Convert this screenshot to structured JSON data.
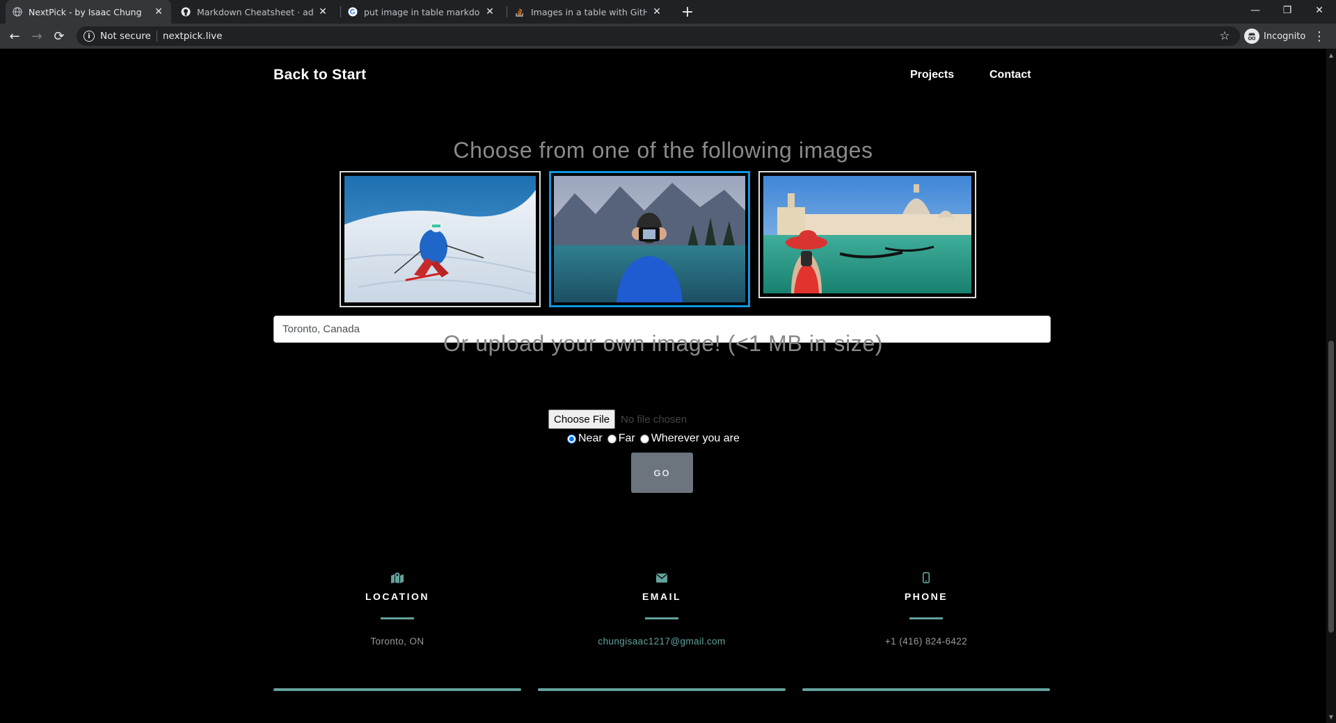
{
  "browser": {
    "tabs": [
      {
        "title": "NextPick - by Isaac Chung",
        "icon": "globe-icon",
        "active": true
      },
      {
        "title": "Markdown Cheatsheet · adam-p/",
        "icon": "github-icon",
        "active": false
      },
      {
        "title": "put image in table markdown - G",
        "icon": "google-icon",
        "active": false
      },
      {
        "title": "Images in a table with GitHub ma",
        "icon": "stackoverflow-icon",
        "active": false
      }
    ],
    "security_label": "Not secure",
    "url": "nextpick.live",
    "profile_label": "Incognito"
  },
  "nav": {
    "brand": "Back to Start",
    "links": [
      "Projects",
      "Contact"
    ]
  },
  "chooser": {
    "heading": "Choose from one of the following images",
    "images": [
      {
        "subject": "skier on snowy slope",
        "selected": false
      },
      {
        "subject": "person taking selfie by mountain lake",
        "selected": true
      },
      {
        "subject": "woman in red hat at Venice canal",
        "selected": false
      }
    ],
    "location_value": "Toronto, Canada"
  },
  "upload": {
    "heading": "Or upload your own image! (<1 MB in size)",
    "choose_file_label": "Choose File",
    "no_file_label": "No file chosen",
    "options": [
      "Near",
      "Far",
      "Wherever you are"
    ],
    "selected_option": "Near",
    "go_label": "GO"
  },
  "contact": [
    {
      "icon": "map-marked-icon",
      "title": "LOCATION",
      "value": "Toronto, ON"
    },
    {
      "icon": "envelope-icon",
      "title": "EMAIL",
      "value": "chungisaac1217@gmail.com"
    },
    {
      "icon": "mobile-phone-icon",
      "title": "PHONE",
      "value": "+1 (416) 824-6422"
    }
  ],
  "colors": {
    "accent": "#64a19d",
    "selected_border": "#0d97e0",
    "go_button": "#6c757d"
  }
}
